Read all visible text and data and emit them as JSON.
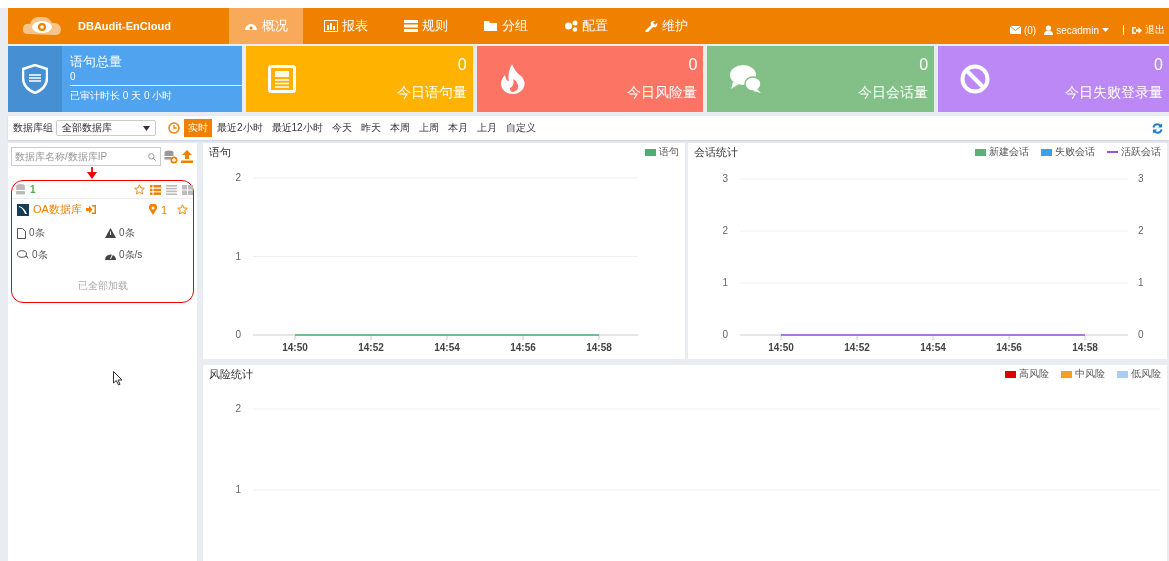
{
  "header": {
    "brand": "DBAudit-EnCloud",
    "menu": [
      {
        "label": "概况",
        "selected": true
      },
      {
        "label": "报表",
        "selected": false
      },
      {
        "label": "规则",
        "selected": false
      },
      {
        "label": "分组",
        "selected": false
      },
      {
        "label": "配置",
        "selected": false
      },
      {
        "label": "维护",
        "selected": false
      }
    ],
    "mail_count": "(0)",
    "user": "secadmin",
    "logout": "退出"
  },
  "summary": {
    "title": "语句总量",
    "value": "0",
    "duration": "已审计时长 0 天 0 小时",
    "color": "#4fa3ef"
  },
  "stat_cards": [
    {
      "kind": "sql",
      "value": "0",
      "label": "今日语句量",
      "color": "#ffb300"
    },
    {
      "kind": "fire",
      "value": "0",
      "label": "今日风险量",
      "color": "#fc7463"
    },
    {
      "kind": "chat",
      "value": "0",
      "label": "今日会话量",
      "color": "#82c087"
    },
    {
      "kind": "ban",
      "value": "0",
      "label": "今日失败登录量",
      "color": "#bb88f5"
    }
  ],
  "filter": {
    "group_label": "数据库组",
    "group_value": "全部数据库",
    "ranges": [
      {
        "label": "实时",
        "selected": true
      },
      {
        "label": "最近2小时",
        "selected": false
      },
      {
        "label": "最近12小时",
        "selected": false
      },
      {
        "label": "今天",
        "selected": false
      },
      {
        "label": "昨天",
        "selected": false
      },
      {
        "label": "本周",
        "selected": false
      },
      {
        "label": "上周",
        "selected": false
      },
      {
        "label": "本月",
        "selected": false
      },
      {
        "label": "上月",
        "selected": false
      },
      {
        "label": "自定义",
        "selected": false
      }
    ]
  },
  "sidebar": {
    "search": {
      "placeholder": "数据库名称/数据库IP"
    },
    "db_count": "1",
    "views": [
      {
        "kind": "list",
        "selected": true
      },
      {
        "kind": "lines",
        "selected": false
      },
      {
        "kind": "grid",
        "selected": false
      }
    ],
    "databases": [
      {
        "name": "OA数据库",
        "location_count": "1",
        "statements": "0条",
        "risks": "0条",
        "sessions": "0条",
        "rate": "0条/s"
      }
    ],
    "footer": "已全部加载"
  },
  "statement_chart": {
    "title": "语句",
    "chart_data": {
      "type": "line",
      "categories": [
        "14:50",
        "14:52",
        "14:54",
        "14:56",
        "14:58"
      ],
      "yticks": [
        0,
        1,
        2
      ],
      "ylim": [
        0,
        2
      ],
      "series": [
        {
          "name": "语句",
          "color": "#4caf72",
          "values": [
            0,
            0,
            0,
            0,
            0
          ]
        }
      ]
    }
  },
  "session_chart": {
    "title": "会话统计",
    "right_axis_labels": [
      "3",
      "2",
      "1",
      "0"
    ],
    "chart_data": {
      "type": "line",
      "categories": [
        "14:50",
        "14:52",
        "14:54",
        "14:56",
        "14:58"
      ],
      "yticks": [
        0,
        1,
        2,
        3
      ],
      "ylim": [
        0,
        3
      ],
      "series": [
        {
          "name": "新建会话",
          "color": "#5ab177",
          "values": [
            null,
            null,
            null,
            null,
            null
          ]
        },
        {
          "name": "失败会话",
          "color": "#3ba1ee",
          "values": [
            null,
            null,
            null,
            null,
            null
          ]
        },
        {
          "name": "活跃会话",
          "color": "#9b51e0",
          "values": [
            0,
            0,
            0,
            0,
            0
          ]
        }
      ]
    }
  },
  "risk_chart": {
    "title": "风险统计",
    "chart_data": {
      "type": "bar",
      "yticks": [
        1,
        2
      ],
      "ylim": [
        0,
        2
      ],
      "series": [
        {
          "name": "高风险",
          "color": "#e00000"
        },
        {
          "name": "中风险",
          "color": "#f5a11c"
        },
        {
          "name": "低风险",
          "color": "#a9cdf2"
        }
      ]
    }
  }
}
